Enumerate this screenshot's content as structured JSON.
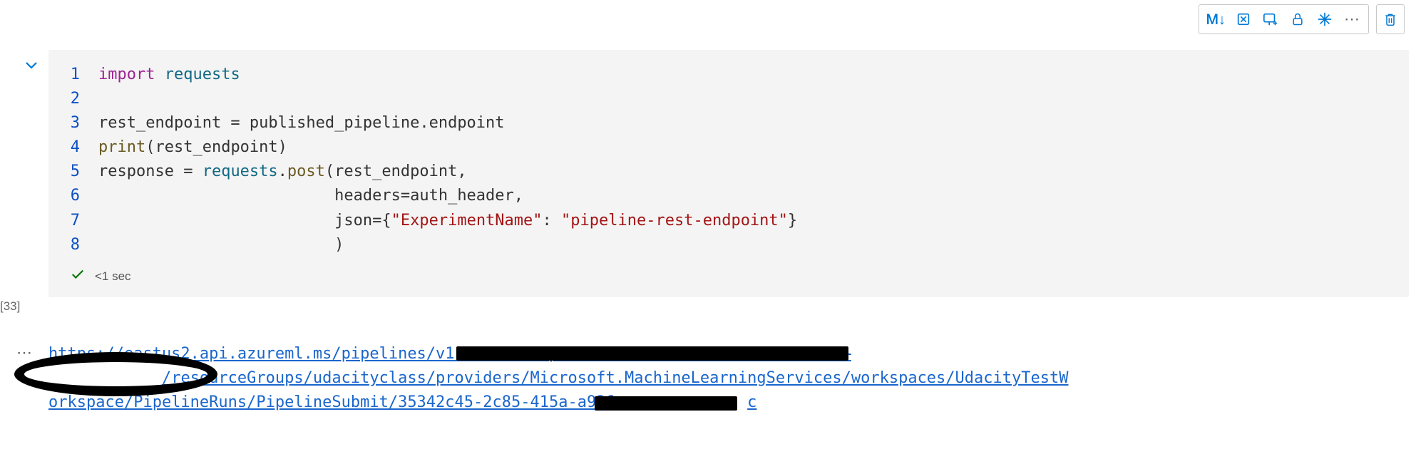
{
  "toolbar": {
    "markdown_label": "M↓",
    "icons": {
      "cut": "cut-cell-icon",
      "insert": "insert-below-icon",
      "lock": "lock-icon",
      "freeze": "freeze-icon",
      "more": "more-icon",
      "trash": "trash-icon"
    }
  },
  "cell": {
    "execution_count": "[33]",
    "exec_time": "<1 sec",
    "code": {
      "lines": [
        "1",
        "2",
        "3",
        "4",
        "5",
        "6",
        "7",
        "8"
      ],
      "l1_kw": "import",
      "l1_mod": "requests",
      "l3": "rest_endpoint = published_pipeline.endpoint",
      "l4_fn": "print",
      "l4_rest": "(rest_endpoint)",
      "l5_a": "response = ",
      "l5_b": "requests",
      "l5_c": ".",
      "l5_d": "post",
      "l5_e": "(rest_endpoint,",
      "l6": "                         headers=auth_header,",
      "l7_a": "                         json={",
      "l7_s1": "\"ExperimentName\"",
      "l7_b": ": ",
      "l7_s2": "\"pipeline-rest-endpoint\"",
      "l7_c": "}",
      "l8": "                         )"
    }
  },
  "output": {
    "seg1": "https://eastus2.api.azureml.ms/pipelines/v1.",
    "seg2": "/resourceGroups/udacityclass/providers/Microsoft.MachineLearningServices/workspaces/UdacityTestW",
    "seg3": "orkspace/PipelineRuns/PipelineSubmit/35342c45-2c85-415a-a936-",
    "seg4": "c",
    "more_dots": "⋯"
  }
}
